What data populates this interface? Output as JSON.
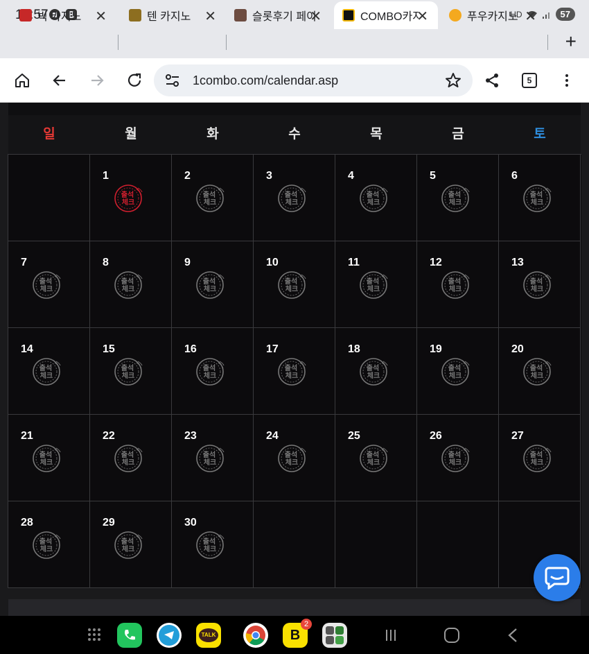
{
  "status": {
    "time": "12:57",
    "battery": "57",
    "network": "HD"
  },
  "tabs": [
    {
      "label": "빅 카지노",
      "color": "#c62828"
    },
    {
      "label": "텐 카지노",
      "color": "#8d6e20"
    },
    {
      "label": "슬롯후기 페이",
      "color": "#6d4c41"
    },
    {
      "label": "COMBO카지노",
      "color": "#f2b705"
    },
    {
      "label": "푸우카지노",
      "color": "#f4a91f"
    }
  ],
  "toolbar": {
    "url": "1combo.com/calendar.asp",
    "tab_count": "5"
  },
  "calendar": {
    "weekdays": [
      "일",
      "월",
      "화",
      "수",
      "목",
      "금",
      "토"
    ],
    "sunday_color": "#e53935",
    "saturday_color": "#2f8fe0",
    "stamp_text": "출석체크",
    "checked_day": 1,
    "days": [
      "",
      "1",
      "2",
      "3",
      "4",
      "5",
      "6",
      "7",
      "8",
      "9",
      "10",
      "11",
      "12",
      "13",
      "14",
      "15",
      "16",
      "17",
      "18",
      "19",
      "20",
      "21",
      "22",
      "23",
      "24",
      "25",
      "26",
      "27",
      "28",
      "29",
      "30",
      "",
      "",
      "",
      ""
    ]
  }
}
